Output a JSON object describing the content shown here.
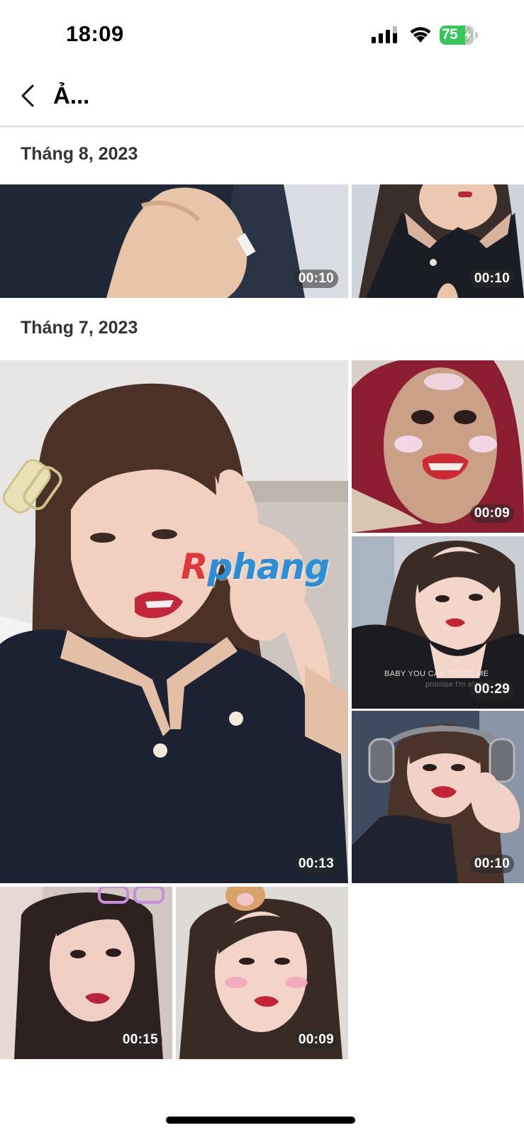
{
  "status_bar": {
    "time": "18:09",
    "battery_level": "75",
    "signal_icon": "cellular-signal-icon",
    "wifi_icon": "wifi-icon",
    "battery_color": "#34c759"
  },
  "nav": {
    "back_icon": "chevron-left-icon",
    "title": "Ả..."
  },
  "sections": [
    {
      "header": "Tháng 8, 2023",
      "videos": [
        {
          "duration": "00:10"
        },
        {
          "duration": "00:10"
        }
      ]
    },
    {
      "header": "Tháng 7, 2023",
      "videos": [
        {
          "duration": "00:13",
          "watermark": "Rphang"
        },
        {
          "duration": "00:09"
        },
        {
          "duration": "00:29",
          "caption": "BABY YOU CAN TRUST ME",
          "caption_sub": "promise I'm alone"
        },
        {
          "duration": "00:10"
        },
        {
          "duration": "00:15"
        },
        {
          "duration": "00:09"
        }
      ]
    }
  ]
}
